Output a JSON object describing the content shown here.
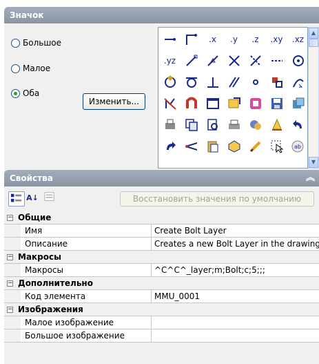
{
  "icon_panel": {
    "title": "Значок",
    "options": [
      {
        "label": "Большое",
        "checked": false
      },
      {
        "label": "Малое",
        "checked": false
      },
      {
        "label": "Оба",
        "checked": true
      }
    ],
    "change_button": "Изменить..."
  },
  "icon_grid": {
    "row1": [
      ".x",
      ".y",
      ".z",
      ".xy",
      ".xz"
    ],
    "row2_first": ".yz"
  },
  "properties_panel": {
    "title": "Свойства",
    "collapse_symbol": "︽",
    "restore_button": "Восстановить значения по умолчанию",
    "sort_symbol": "A↓",
    "categories": {
      "general": "Общие",
      "macros": "Макросы",
      "advanced": "Дополнительно",
      "images": "Изображения"
    },
    "rows": {
      "name_label": "Имя",
      "name_value": "Create Bolt Layer",
      "desc_label": "Описание",
      "desc_value": "Creates a new Bolt Layer in the drawing",
      "macro_label": "Макросы",
      "macro_value": "^C^C^_layer;m;Bolt;c;5;;;",
      "element_id_label": "Код элемента",
      "element_id_value": "MMU_0001",
      "small_image_label": "Малое изображение",
      "small_image_value": "",
      "large_image_label": "Большое изображение",
      "large_image_value": ""
    },
    "toggle_symbol": "−"
  }
}
